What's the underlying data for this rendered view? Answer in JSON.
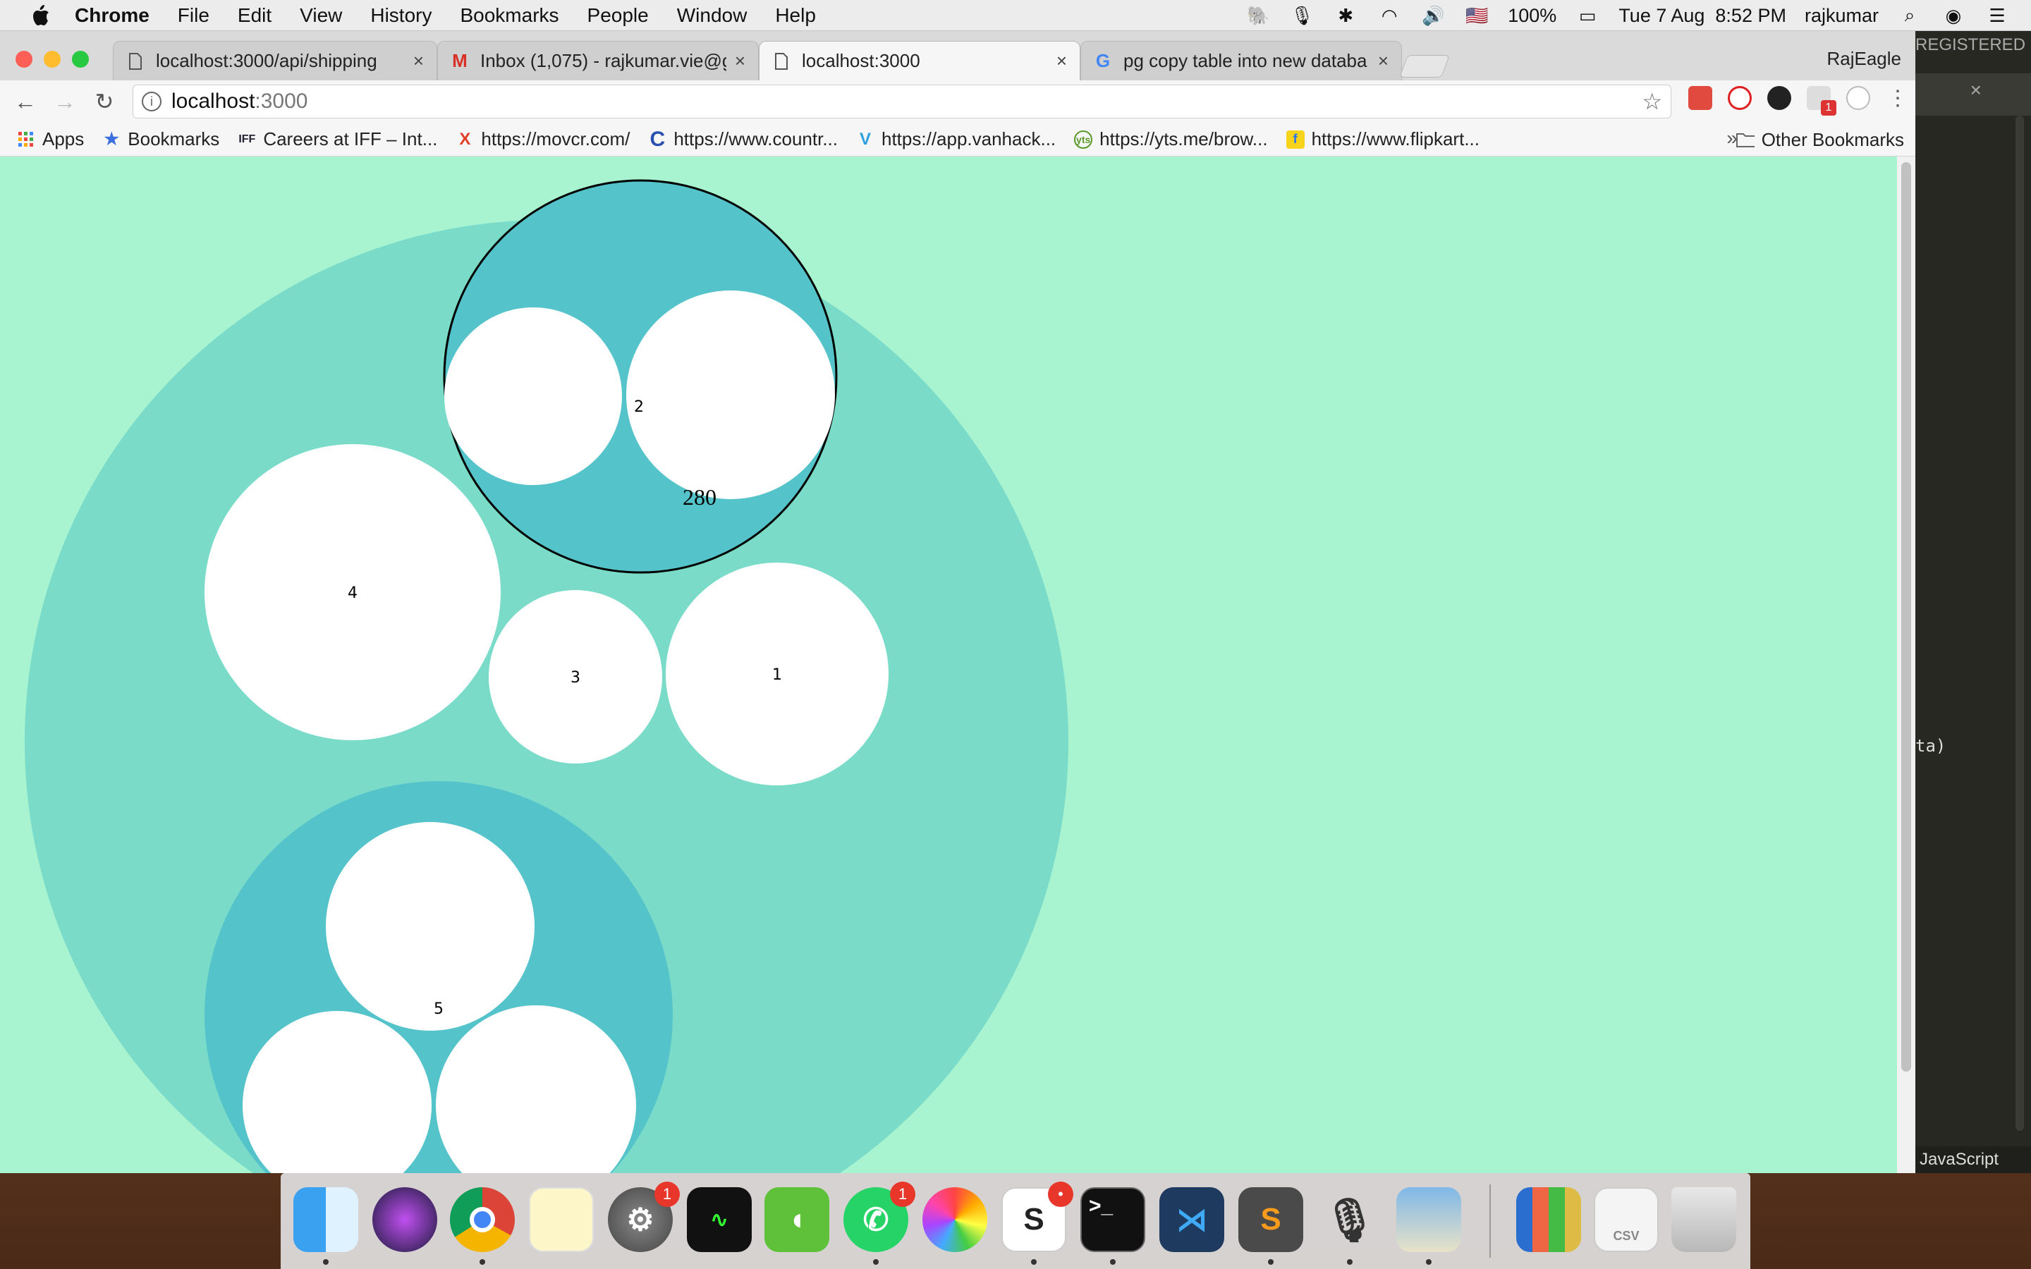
{
  "menubar": {
    "app_name": "Chrome",
    "items": [
      "File",
      "Edit",
      "View",
      "History",
      "Bookmarks",
      "People",
      "Window",
      "Help"
    ],
    "battery": "100%",
    "datetime": "Tue 7 Aug  8:52 PM",
    "user": "rajkumar"
  },
  "editor": {
    "registered_text": "REGISTERED",
    "close": "×",
    "code_fragment": "ta)",
    "status_lang": "JavaScript"
  },
  "chrome": {
    "tabs": [
      {
        "title": "localhost:3000/api/shipping",
        "close": "×"
      },
      {
        "title": "Inbox (1,075) - rajkumar.vie@g",
        "close": "×"
      },
      {
        "title": "localhost:3000",
        "close": "×"
      },
      {
        "title": "pg copy table into new databa",
        "close": "×"
      }
    ],
    "profile_name": "RajEagle",
    "url_host": "localhost",
    "url_port": ":3000",
    "extension_badge": "1"
  },
  "bookmarks": {
    "items": [
      {
        "label": "Apps",
        "icon": "apps-grid-icon"
      },
      {
        "label": "Bookmarks",
        "icon": "star-icon"
      },
      {
        "label": "Careers at IFF – Int...",
        "icon": "iff-icon"
      },
      {
        "label": "https://movcr.com/",
        "icon": "x-logo-icon"
      },
      {
        "label": "https://www.countr...",
        "icon": "c-logo-icon"
      },
      {
        "label": "https://app.vanhack...",
        "icon": "vanhack-icon"
      },
      {
        "label": "https://yts.me/brow...",
        "icon": "yts-icon"
      },
      {
        "label": "https://www.flipkart...",
        "icon": "flipkart-icon"
      }
    ],
    "more": "»",
    "other": "Other Bookmarks"
  },
  "page": {
    "background": "#a8f4d0",
    "outer_fill": "#7adbc9",
    "inner_fill": "#54c3ca",
    "leaf_fill": "#ffffff",
    "labels": {
      "group2": "2",
      "value280": "280",
      "leaf4": "4",
      "leaf3": "3",
      "leaf1": "1",
      "group5": "5"
    }
  },
  "dock": {
    "apps": [
      {
        "name": "finder-icon",
        "badge": ""
      },
      {
        "name": "siri-icon",
        "badge": ""
      },
      {
        "name": "chrome-icon",
        "badge": ""
      },
      {
        "name": "notes-icon",
        "badge": ""
      },
      {
        "name": "system-preferences-icon",
        "badge": "1"
      },
      {
        "name": "activity-monitor-icon",
        "badge": ""
      },
      {
        "name": "mouse-app-icon",
        "badge": ""
      },
      {
        "name": "whatsapp-icon",
        "badge": "1"
      },
      {
        "name": "photos-icon",
        "badge": ""
      },
      {
        "name": "slack-icon",
        "badge": "•"
      },
      {
        "name": "terminal-icon",
        "badge": ""
      },
      {
        "name": "vscode-icon",
        "badge": ""
      },
      {
        "name": "sublime-text-icon",
        "badge": ""
      },
      {
        "name": "voice-recorder-icon",
        "badge": ""
      },
      {
        "name": "preview-icon",
        "badge": ""
      },
      {
        "name": "books-icon",
        "badge": ""
      },
      {
        "name": "csv-file-icon",
        "badge": ""
      },
      {
        "name": "trash-icon",
        "badge": ""
      }
    ]
  }
}
